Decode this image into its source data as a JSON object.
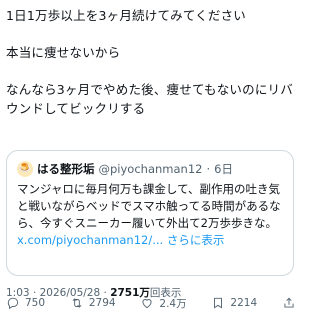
{
  "post": {
    "line1": "1日1万歩以上を3ヶ月続けてみてください",
    "line2": "本当に痩せないから",
    "line3": "なんなら3ヶ月でやめた後、痩せてもないのにリバウンドしてビックリする"
  },
  "quote": {
    "avatar": "🍮",
    "name": "はる整形垢",
    "handle": "@piyochanman12",
    "sep": "·",
    "date": "6日",
    "text": "マンジャロに毎月何万も課金して、副作用の吐き気と戦いながらベッドでスマホ触ってる時間があるなら、今すぐスニーカー履いて外出て2万歩歩きな。",
    "link": "x.com/piyochanman12/...",
    "more": "さらに表示"
  },
  "meta": {
    "time": "1:03",
    "sep": "·",
    "date": "2026/05/28",
    "sep2": "·",
    "views": "2751万",
    "views_label": "回表示"
  },
  "actions": {
    "reply": "750",
    "repost": "2794",
    "like": "2.4万",
    "bookmark": "2214"
  },
  "icons": [
    "reply-icon",
    "repost-icon",
    "like-icon",
    "bookmark-icon",
    "share-icon"
  ]
}
